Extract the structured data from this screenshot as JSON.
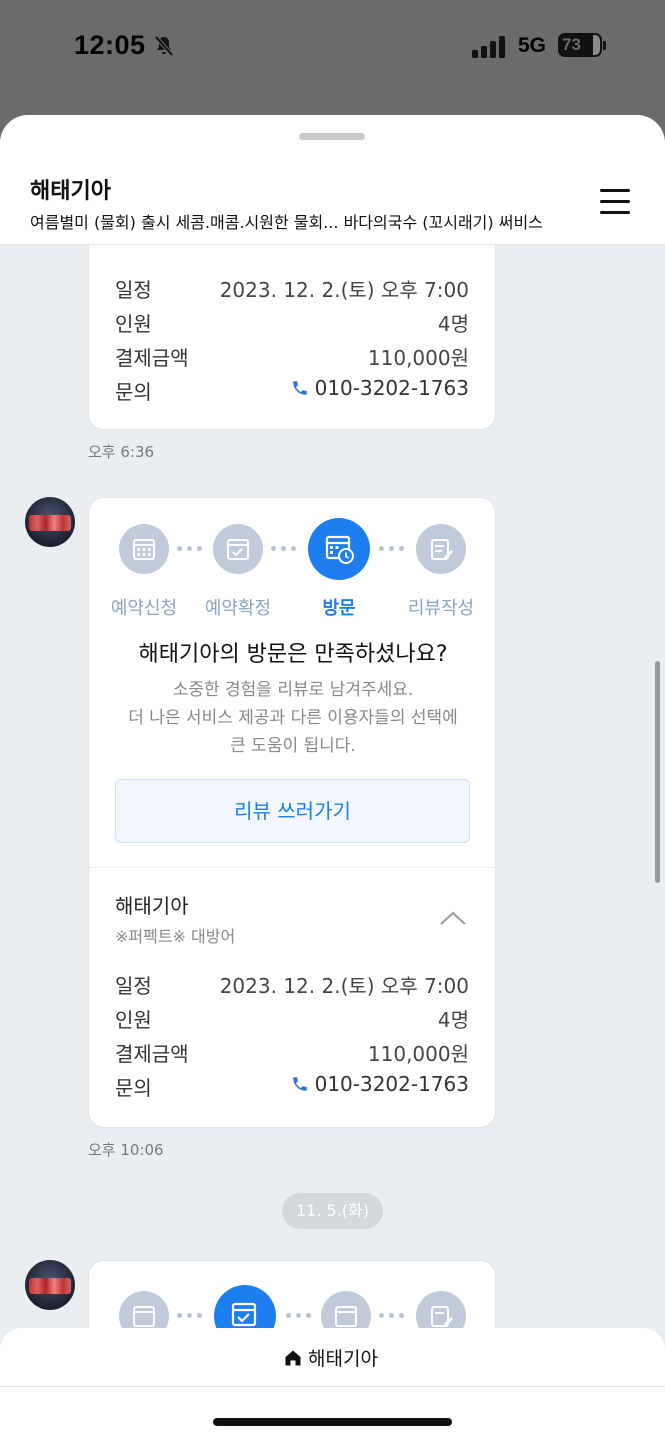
{
  "status": {
    "time": "12:05",
    "network": "5G",
    "battery": 73
  },
  "header": {
    "title": "해태기아",
    "subtitle": "여름별미 (물회) 출시 세콤.매콤.시원한 물회... 바다의국수 (꼬시래기) 써비스"
  },
  "reservation1": {
    "rows": [
      {
        "key": "일정",
        "value": "2023. 12. 2.(토) 오후 7:00"
      },
      {
        "key": "인원",
        "value": "4명"
      },
      {
        "key": "결제금액",
        "value": "110,000원"
      },
      {
        "key": "문의",
        "value": "010-3202-1763"
      }
    ],
    "timestamp": "오후 6:36"
  },
  "visit_card": {
    "steps": [
      {
        "label": "예약신청",
        "icon": "calendar-grid-icon"
      },
      {
        "label": "예약확정",
        "icon": "calendar-check-icon"
      },
      {
        "label": "방문",
        "icon": "calendar-clock-icon",
        "active": true
      },
      {
        "label": "리뷰작성",
        "icon": "edit-note-icon"
      }
    ],
    "question": "해태기아의 방문은 만족하셨나요?",
    "description_lines": [
      "소중한 경험을 리뷰로 남겨주세요.",
      "더 나은 서비스 제공과 다른 이용자들의 선택에",
      "큰 도움이 됩니다."
    ],
    "review_button": "리뷰 쓰러가기",
    "store_name": "해태기아",
    "store_sub": "※퍼펙트※ 대방어",
    "rows": [
      {
        "key": "일정",
        "value": "2023. 12. 2.(토) 오후 7:00"
      },
      {
        "key": "인원",
        "value": "4명"
      },
      {
        "key": "결제금액",
        "value": "110,000원"
      },
      {
        "key": "문의",
        "value": "010-3202-1763"
      }
    ],
    "timestamp": "오후 10:06"
  },
  "date_divider": "11. 5.(화)",
  "bottom": {
    "home_label": "해태기아"
  },
  "colors": {
    "accent": "#1e7ef0",
    "step_inactive": "#bfcbdb",
    "background": "#ebeef1"
  }
}
